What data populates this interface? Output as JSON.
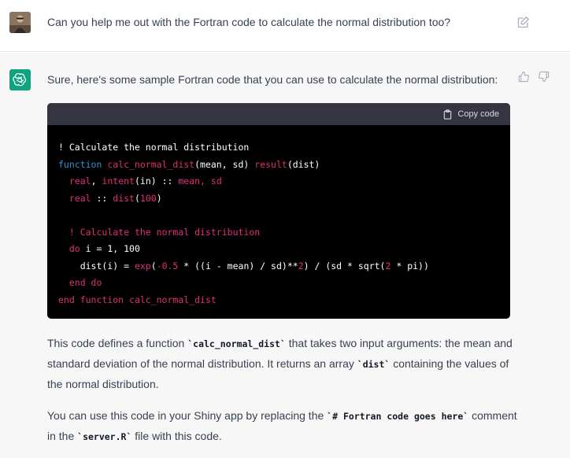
{
  "user_message": {
    "text": "Can you help me out with the Fortran code to calculate the normal distribution too?",
    "avatar": "user-photo",
    "edit_icon": "edit-icon"
  },
  "assistant_message": {
    "avatar_icon": "openai-logo-icon",
    "intro": "Sure, here's some sample Fortran code that you can use to calculate the normal distribution:",
    "code_block": {
      "copy_label": "Copy code",
      "lines": [
        "! Calculate the normal distribution",
        "function calc_normal_dist(mean, sd) result(dist)",
        "  real, intent(in) :: mean, sd",
        "  real :: dist(100)",
        "",
        "  ! Calculate the normal distribution",
        "  do i = 1, 100",
        "    dist(i) = exp(-0.5 * ((i - mean) / sd)**2) / (sd * sqrt(2 * pi))",
        "  end do",
        "end function calc_normal_dist"
      ]
    },
    "para1": {
      "t1": "This code defines a function ",
      "c1": "`calc_normal_dist`",
      "t2": " that takes two input arguments: the mean and standard deviation of the normal distribution. It returns an array ",
      "c2": "`dist`",
      "t3": " containing the values of the normal distribution."
    },
    "para2": {
      "t1": "You can use this code in your Shiny app by replacing the ",
      "c1": "`# Fortran code goes here`",
      "t2": " comment in the ",
      "c2": "`server.R`",
      "t3": " file with this code."
    },
    "feedback": {
      "thumbs_up": "thumbs-up-icon",
      "thumbs_down": "thumbs-down-icon"
    }
  },
  "colors": {
    "assistant_bg": "#f7f7f8",
    "code_bg": "#000000",
    "code_header_bg": "#343541",
    "keyword_blue": "#2e95d3",
    "keyword_red": "#df3079",
    "brand_green": "#10a37f"
  }
}
